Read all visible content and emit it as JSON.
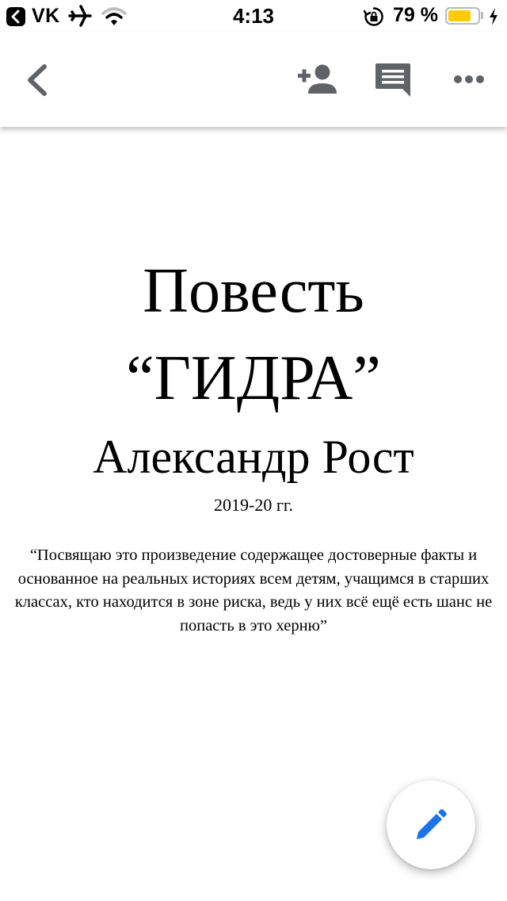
{
  "status_bar": {
    "carrier": "VK",
    "time": "4:13",
    "battery_percent_label": "79 %",
    "battery_level": 0.79,
    "icons": [
      "back-to-app-icon",
      "airplane-icon",
      "wifi-icon",
      "orientation-lock-icon",
      "battery-icon",
      "charging-icon"
    ],
    "battery_color": "#ffcc00"
  },
  "toolbar": {
    "icons": [
      "back-icon",
      "add-person-icon",
      "comment-icon",
      "more-icon"
    ],
    "icon_color": "#5f6368"
  },
  "document": {
    "title_line1": "Повесть",
    "title_line2": "“ГИДРА”",
    "author": "Александр Рост",
    "years": "2019-20 гг.",
    "dedication": "“Посвящаю это произведение содержащее достоверные факты и основанное на реальных историях всем детям, учащимся в старших классах, кто находится в зоне риска, ведь у них всё ещё есть шанс не попасть в это херню”"
  },
  "fab": {
    "icon": "edit-pencil-icon",
    "icon_color": "#1a73e8"
  }
}
